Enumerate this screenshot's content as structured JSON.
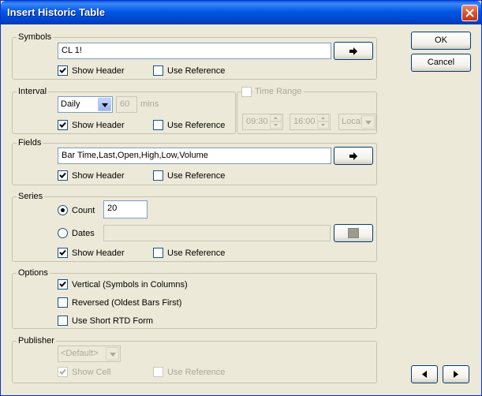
{
  "window": {
    "title": "Insert Historic Table"
  },
  "buttons": {
    "ok": "OK",
    "cancel": "Cancel"
  },
  "symbols": {
    "group_label": "Symbols",
    "value": "CL 1!",
    "show_header": "Show Header",
    "use_reference": "Use Reference",
    "show_header_checked": true,
    "use_reference_checked": false
  },
  "interval": {
    "group_label": "Interval",
    "period": "Daily",
    "minutes": "60",
    "minutes_unit": "mins",
    "show_header": "Show Header",
    "use_reference": "Use Reference",
    "show_header_checked": true,
    "use_reference_checked": false
  },
  "time_range": {
    "label": "Time Range",
    "enabled": false,
    "start": "09:30",
    "end": "16:00",
    "zone": "Local"
  },
  "fields": {
    "group_label": "Fields",
    "value": "Bar Time,Last,Open,High,Low,Volume",
    "show_header": "Show Header",
    "use_reference": "Use Reference",
    "show_header_checked": true,
    "use_reference_checked": false
  },
  "series": {
    "group_label": "Series",
    "count_label": "Count",
    "count_value": "20",
    "count_selected": true,
    "dates_label": "Dates",
    "dates_value": "",
    "show_header": "Show Header",
    "use_reference": "Use Reference",
    "show_header_checked": true,
    "use_reference_checked": false
  },
  "options": {
    "group_label": "Options",
    "vertical": "Vertical (Symbols in Columns)",
    "vertical_checked": true,
    "reversed": "Reversed (Oldest Bars First)",
    "reversed_checked": false,
    "short_rtd": "Use Short RTD Form",
    "short_rtd_checked": false
  },
  "publisher": {
    "group_label": "Publisher",
    "selected": "<Default>",
    "show_cell": "Show Cell",
    "show_cell_checked": true,
    "use_reference": "Use Reference",
    "use_reference_checked": false
  },
  "icons": {
    "arrow": "right-arrow-icon",
    "prev": "left-triangle-icon",
    "next": "right-triangle-icon",
    "close": "close-icon"
  },
  "colors": {
    "titlebar": "#0058e6",
    "face": "#ece9d8",
    "close": "#d74a22",
    "disabled_text": "#aca899"
  }
}
